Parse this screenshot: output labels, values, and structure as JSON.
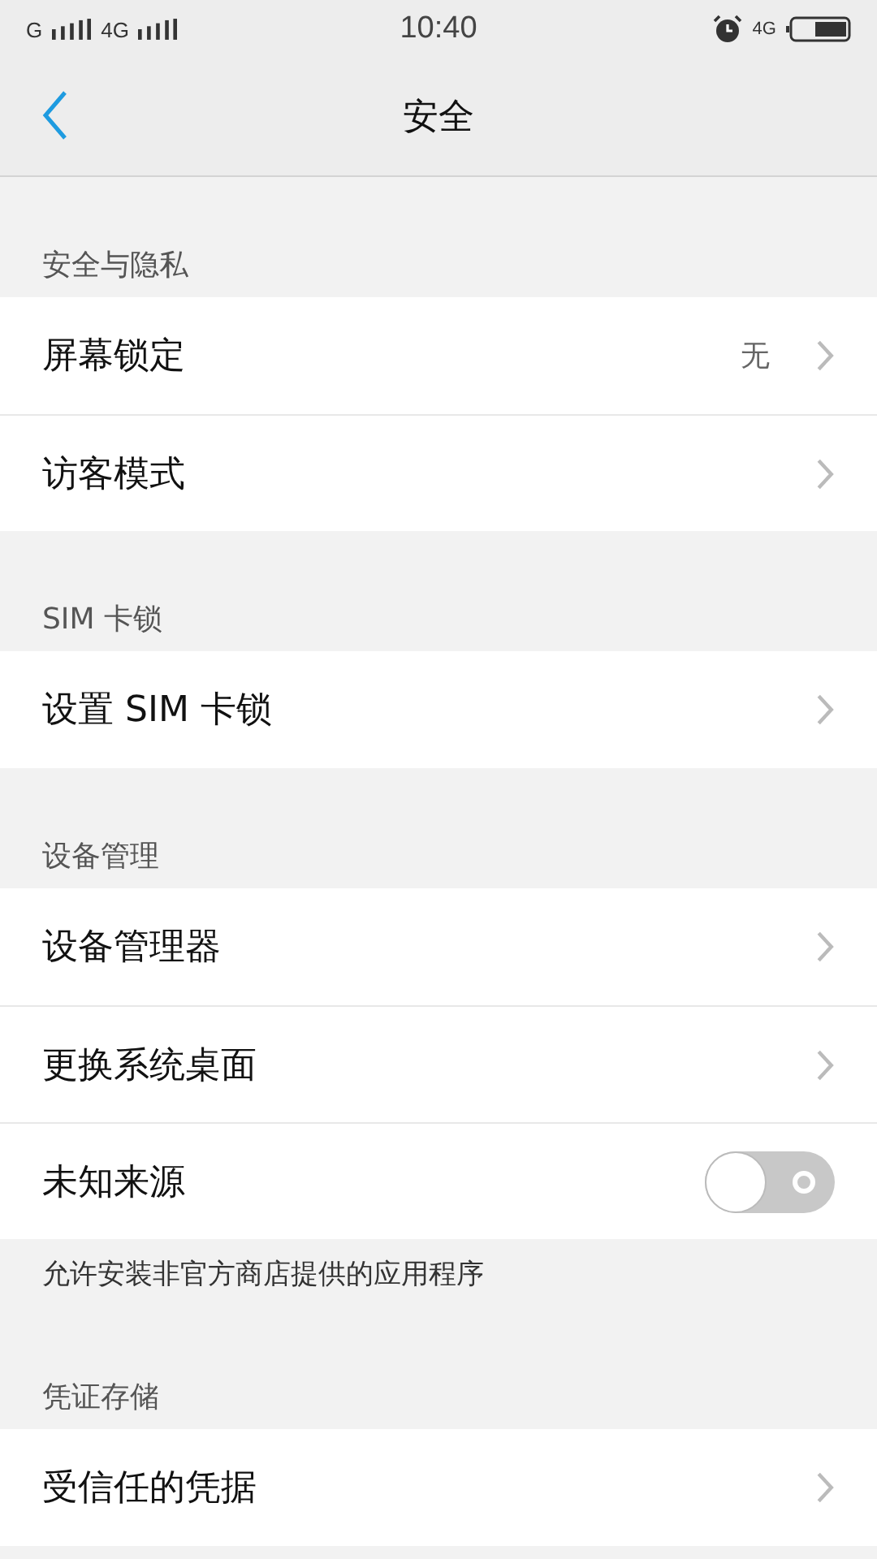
{
  "status_bar": {
    "network_1": "G",
    "network_2": "4G",
    "time": "10:40",
    "data_network": "4G"
  },
  "header": {
    "title": "安全"
  },
  "sections": [
    {
      "title": "安全与隐私",
      "rows": [
        {
          "kind": "link",
          "label": "屏幕锁定",
          "value": "无"
        },
        {
          "kind": "link",
          "label": "访客模式"
        }
      ]
    },
    {
      "title": "SIM 卡锁",
      "rows": [
        {
          "kind": "link",
          "label": "设置 SIM 卡锁"
        }
      ]
    },
    {
      "title": "设备管理",
      "rows": [
        {
          "kind": "link",
          "label": "设备管理器"
        },
        {
          "kind": "link",
          "label": "更换系统桌面"
        },
        {
          "kind": "toggle",
          "label": "未知来源",
          "on": false
        }
      ],
      "note": "允许安装非官方商店提供的应用程序"
    },
    {
      "title": "凭证存储",
      "rows": [
        {
          "kind": "link",
          "label": "受信任的凭据"
        }
      ]
    }
  ]
}
